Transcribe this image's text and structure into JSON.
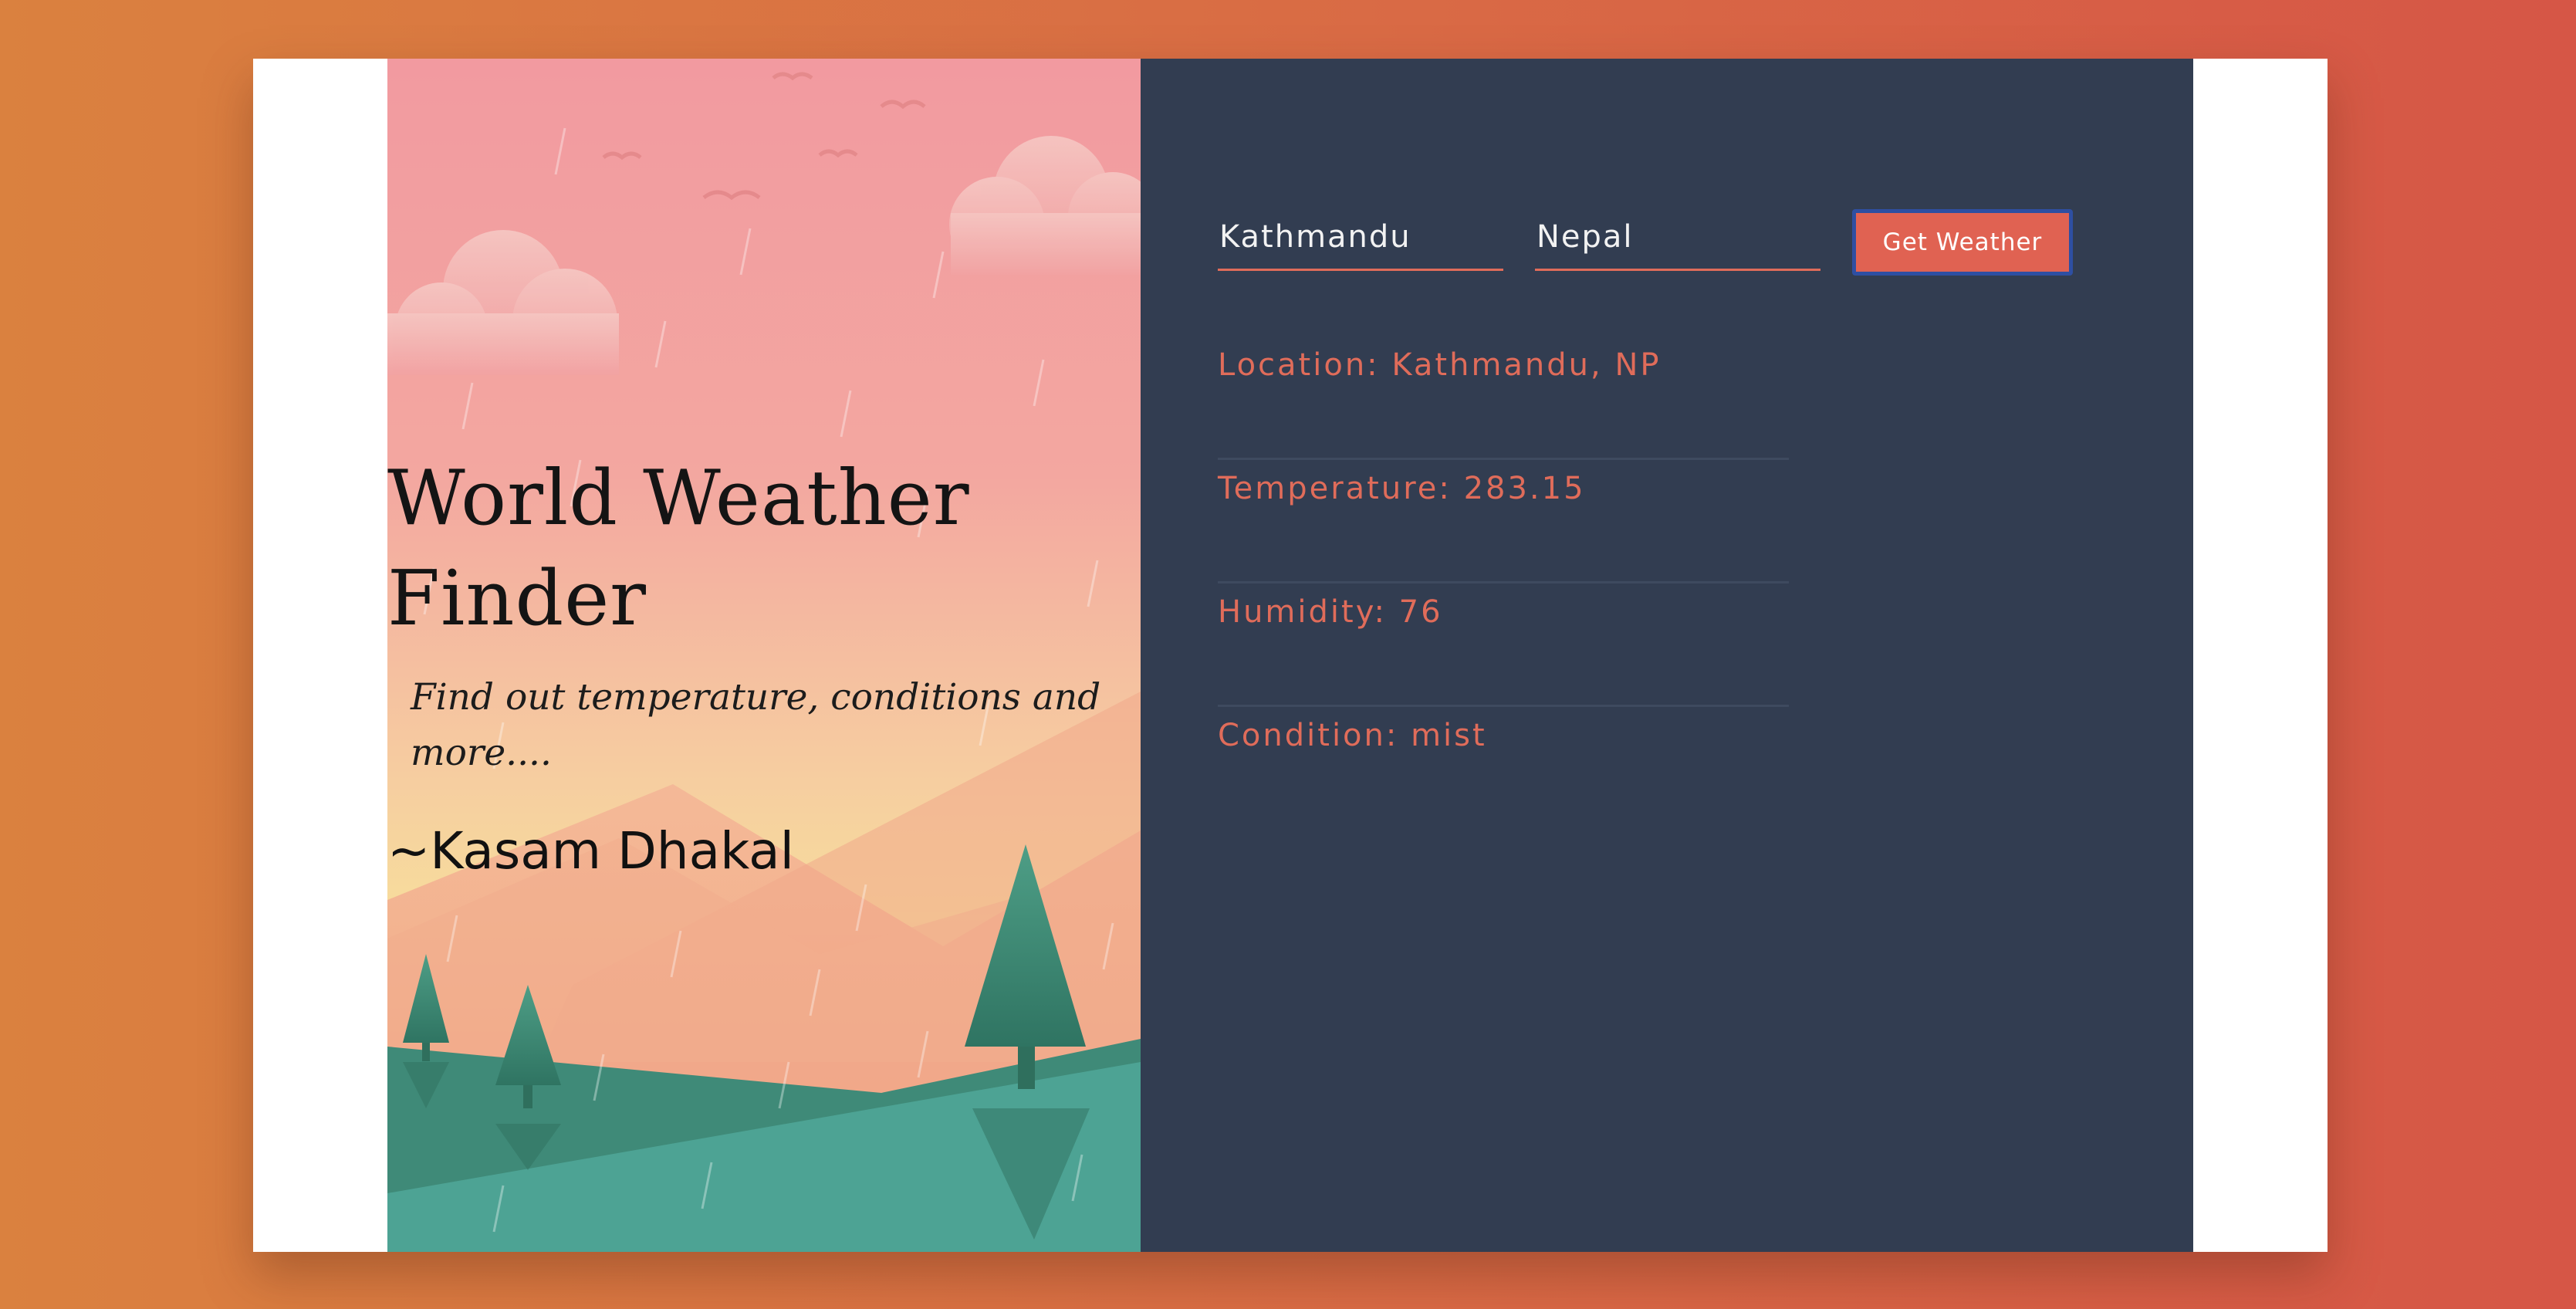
{
  "hero": {
    "title_line1": "World Weather",
    "title_line2": "Finder",
    "subtitle_line1": "Find out temperature, conditions and",
    "subtitle_line2": "more....",
    "author": "~Kasam Dhakal"
  },
  "form": {
    "city_value": "Kathmandu",
    "country_value": "Nepal",
    "submit_label": "Get Weather"
  },
  "results": {
    "location": "Location: Kathmandu, NP",
    "temperature": "Temperature: 283.15",
    "humidity": "Humidity: 76",
    "condition": "Condition: mist"
  },
  "colors": {
    "background_start": "#da813f",
    "background_end": "#d65646",
    "panel": "#323d51",
    "accent": "#e06c5a",
    "button_border": "#2e4fa2"
  }
}
